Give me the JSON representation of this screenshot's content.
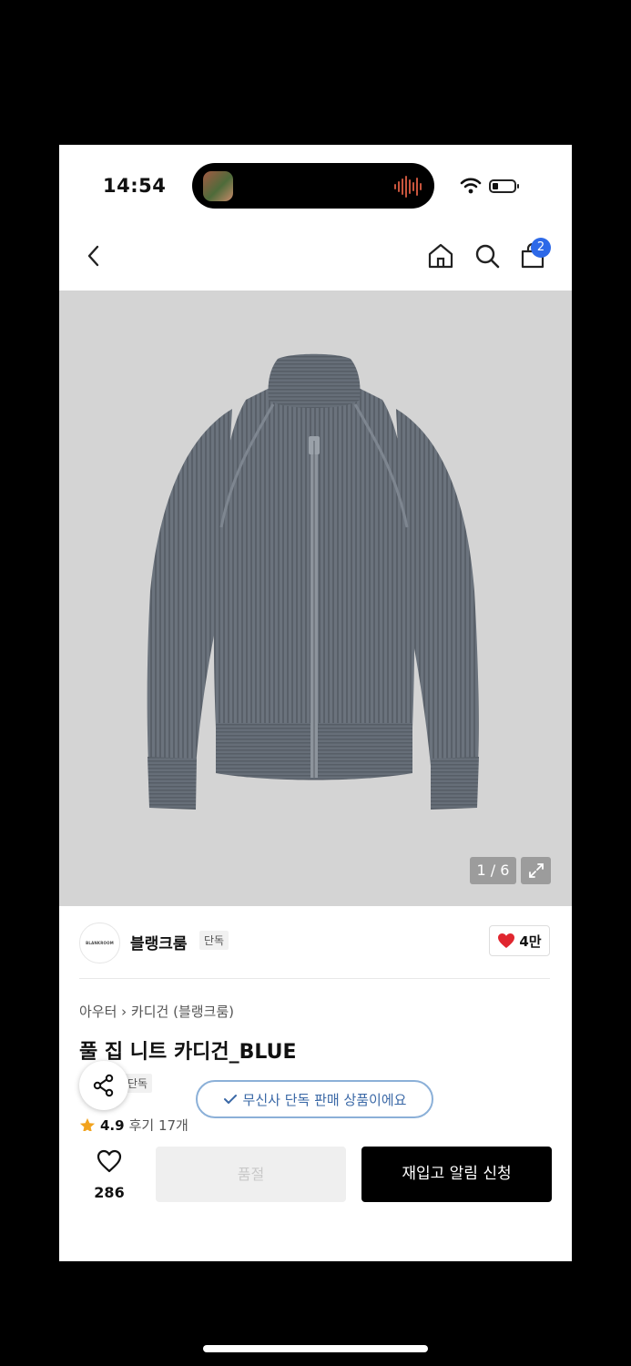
{
  "status_bar": {
    "time": "14:54"
  },
  "nav": {
    "cart_count": "2"
  },
  "gallery": {
    "pager": "1 / 6"
  },
  "brand": {
    "logo_text": "BLANKROOM",
    "name": "블랭크룸",
    "tag": "단독",
    "likes": "4만"
  },
  "product": {
    "breadcrumb": "아우터 › 카디건 (블랭크룸)",
    "title": "풀 집 니트 카디건_BLUE",
    "tag": "단독",
    "rating": "4.9",
    "reviews": "후기 17개"
  },
  "toast": {
    "text": "무신사 단독 판매 상품이에요"
  },
  "bottom": {
    "wish_count": "286",
    "soldout_label": "품절",
    "restock_label": "재입고 알림 신청"
  },
  "colors": {
    "accent": "#2d69e8",
    "heart": "#e0262f",
    "toast": "#3a68a6",
    "star": "#f2a31e",
    "sweater": "#6b737d"
  }
}
